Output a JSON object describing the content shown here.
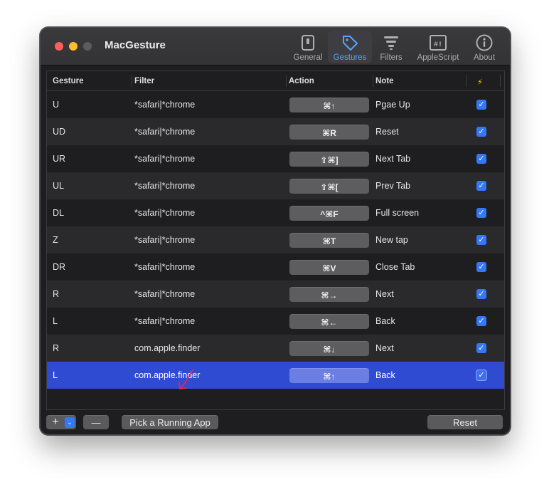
{
  "window": {
    "title": "MacGesture"
  },
  "toolbar": {
    "items": [
      {
        "label": "General",
        "icon": "general-icon",
        "active": false
      },
      {
        "label": "Gestures",
        "icon": "gestures-tag-icon",
        "active": true
      },
      {
        "label": "Filters",
        "icon": "filters-funnel-icon",
        "active": false
      },
      {
        "label": "AppleScript",
        "icon": "applescript-icon",
        "active": false
      },
      {
        "label": "About",
        "icon": "info-icon",
        "active": false
      }
    ]
  },
  "table": {
    "columns": {
      "gesture": "Gesture",
      "filter": "Filter",
      "action": "Action",
      "note": "Note",
      "enabled": "⚡"
    },
    "rows": [
      {
        "gesture": "U",
        "filter": "*safari|*chrome",
        "action": "⌘↑",
        "note": "Pgae Up",
        "enabled": true
      },
      {
        "gesture": "UD",
        "filter": "*safari|*chrome",
        "action": "⌘R",
        "note": "Reset",
        "enabled": true
      },
      {
        "gesture": "UR",
        "filter": "*safari|*chrome",
        "action": "⇧⌘]",
        "note": "Next Tab",
        "enabled": true
      },
      {
        "gesture": "UL",
        "filter": "*safari|*chrome",
        "action": "⇧⌘[",
        "note": "Prev Tab",
        "enabled": true
      },
      {
        "gesture": "DL",
        "filter": "*safari|*chrome",
        "action": "^⌘F",
        "note": "Full screen",
        "enabled": true
      },
      {
        "gesture": "Z",
        "filter": "*safari|*chrome",
        "action": "⌘T",
        "note": "New tap",
        "enabled": true
      },
      {
        "gesture": "DR",
        "filter": "*safari|*chrome",
        "action": "⌘V",
        "note": "Close Tab",
        "enabled": true
      },
      {
        "gesture": "R",
        "filter": "*safari|*chrome",
        "action": "⌘→",
        "note": "Next",
        "enabled": true
      },
      {
        "gesture": "L",
        "filter": "*safari|*chrome",
        "action": "⌘←",
        "note": "Back",
        "enabled": true
      },
      {
        "gesture": "R",
        "filter": "com.apple.finder",
        "action": "⌘↓",
        "note": "Next",
        "enabled": true
      },
      {
        "gesture": "L",
        "filter": "com.apple.finder",
        "action": "⌘↑",
        "note": "Back",
        "enabled": true,
        "selected": true
      }
    ]
  },
  "footer": {
    "add_label": "+",
    "add_menu_glyph": "⌄",
    "remove_label": "—",
    "pick_app_label": "Pick a Running App",
    "reset_label": "Reset"
  },
  "colors": {
    "accent": "#3478f6",
    "selection": "#2f4bd1",
    "annotation": "#e0245e"
  }
}
